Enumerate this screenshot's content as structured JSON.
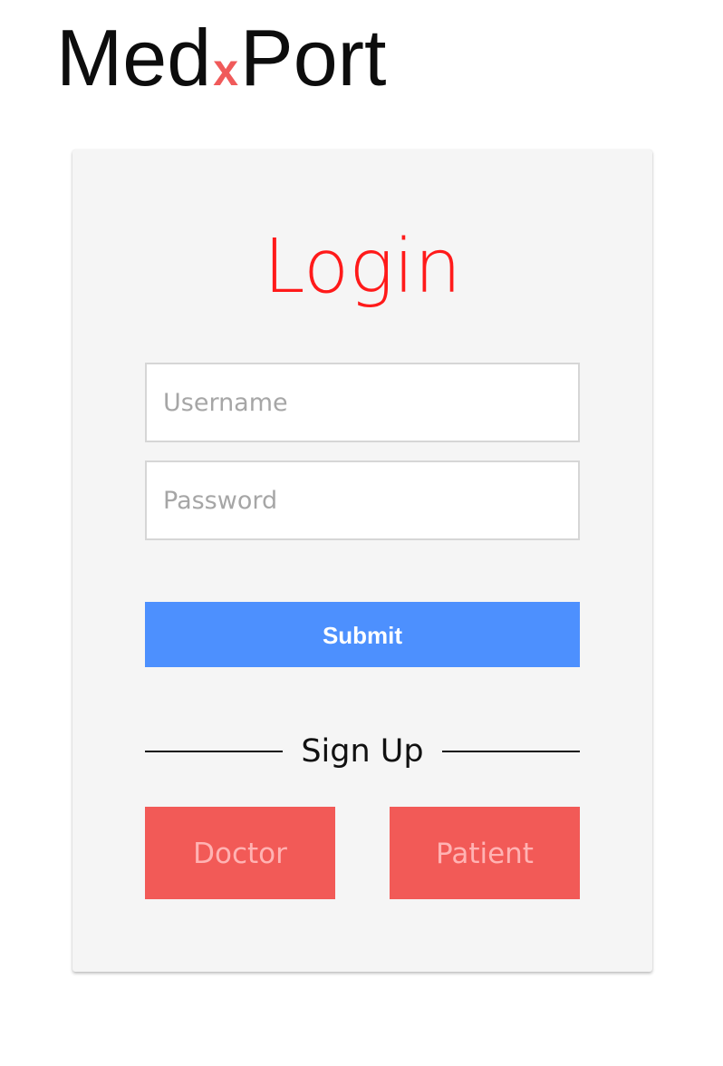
{
  "brand": {
    "prefix": "Med",
    "middle": "x",
    "suffix": "Port",
    "accent_color": "#f05a5a"
  },
  "login": {
    "title": "Login",
    "title_color": "#ff1a1a",
    "username_placeholder": "Username",
    "password_placeholder": "Password",
    "submit_label": "Submit",
    "submit_color": "#4d90fe"
  },
  "signup": {
    "heading": "Sign Up",
    "doctor_label": "Doctor",
    "patient_label": "Patient",
    "button_color": "#f25a57"
  }
}
